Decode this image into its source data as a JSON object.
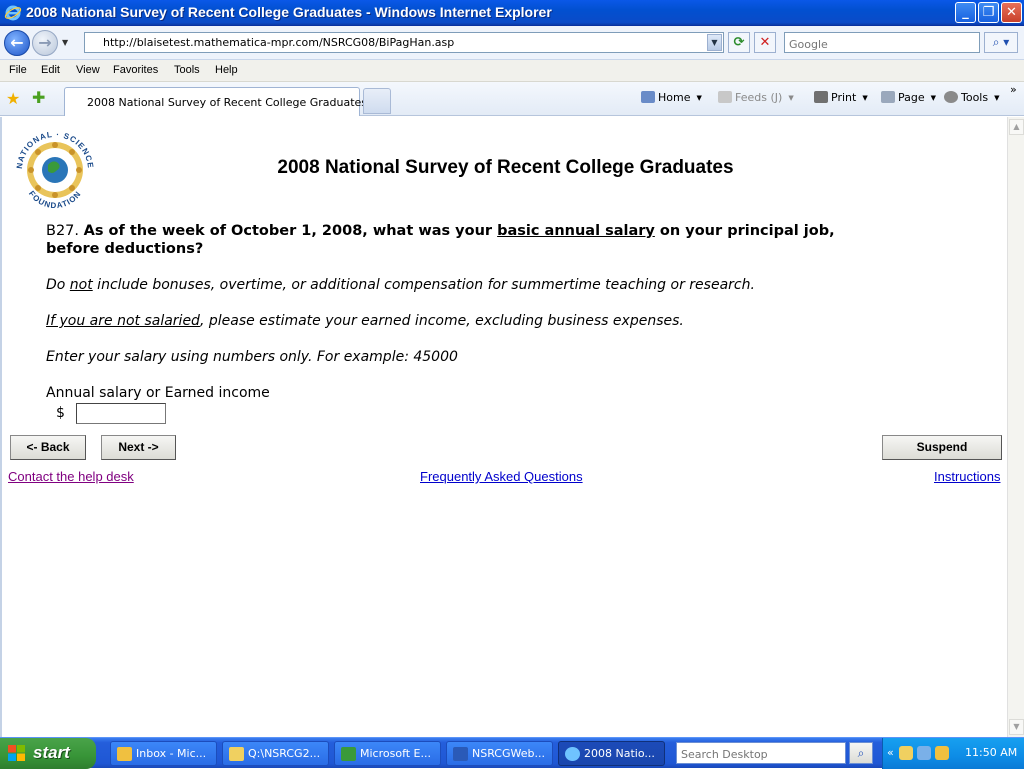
{
  "window": {
    "title": "2008 National Survey of Recent College Graduates - Windows Internet Explorer"
  },
  "address_bar": {
    "url": "http://blaisetest.mathematica-mpr.com/NSRCG08/BiPagHan.asp",
    "search_placeholder": "Google"
  },
  "menu": [
    "File",
    "Edit",
    "View",
    "Favorites",
    "Tools",
    "Help"
  ],
  "tab_bar": {
    "active_tab": "2008 National Survey of Recent College Graduates",
    "commands": {
      "home": "Home",
      "feeds": "Feeds (J)",
      "print": "Print",
      "page": "Page",
      "tools": "Tools"
    }
  },
  "page": {
    "logo_text": "NATIONAL SCIENCE FOUNDATION",
    "title": "2008 National Survey of Recent College Graduates",
    "question": {
      "number": "B27.",
      "text_before": "As of the week of October 1, 2008, what was your ",
      "text_underlined": "basic annual salary",
      "text_after_line1": " on your principal job,",
      "text_line2": "before deductions?"
    },
    "instruction1": {
      "prefix": "Do ",
      "underlined": "not",
      "rest": " include bonuses, overtime, or additional compensation for summertime teaching or research."
    },
    "instruction2": {
      "underlined": "If you are not salaried",
      "rest": ", please estimate your earned income, excluding business expenses."
    },
    "instruction3": "Enter your salary using numbers only. For example: 45000",
    "field_label": "Annual salary or Earned income",
    "currency_symbol": "$",
    "salary_value": ""
  },
  "buttons": {
    "back": "<- Back",
    "next": "Next ->",
    "suspend": "Suspend"
  },
  "links": {
    "help_desk": "Contact the help desk",
    "faq": "Frequently Asked Questions",
    "instructions": "Instructions"
  },
  "colors": {
    "visited_link": "#800080",
    "link": "#0000cc"
  },
  "taskbar": {
    "start_label": "start",
    "tasks": [
      "Inbox - Mic...",
      "Q:\\NSRCG2...",
      "Microsoft E...",
      "NSRCGWeb...",
      "2008 Natio..."
    ],
    "search_placeholder": "Search Desktop",
    "clock": "11:50 AM"
  }
}
